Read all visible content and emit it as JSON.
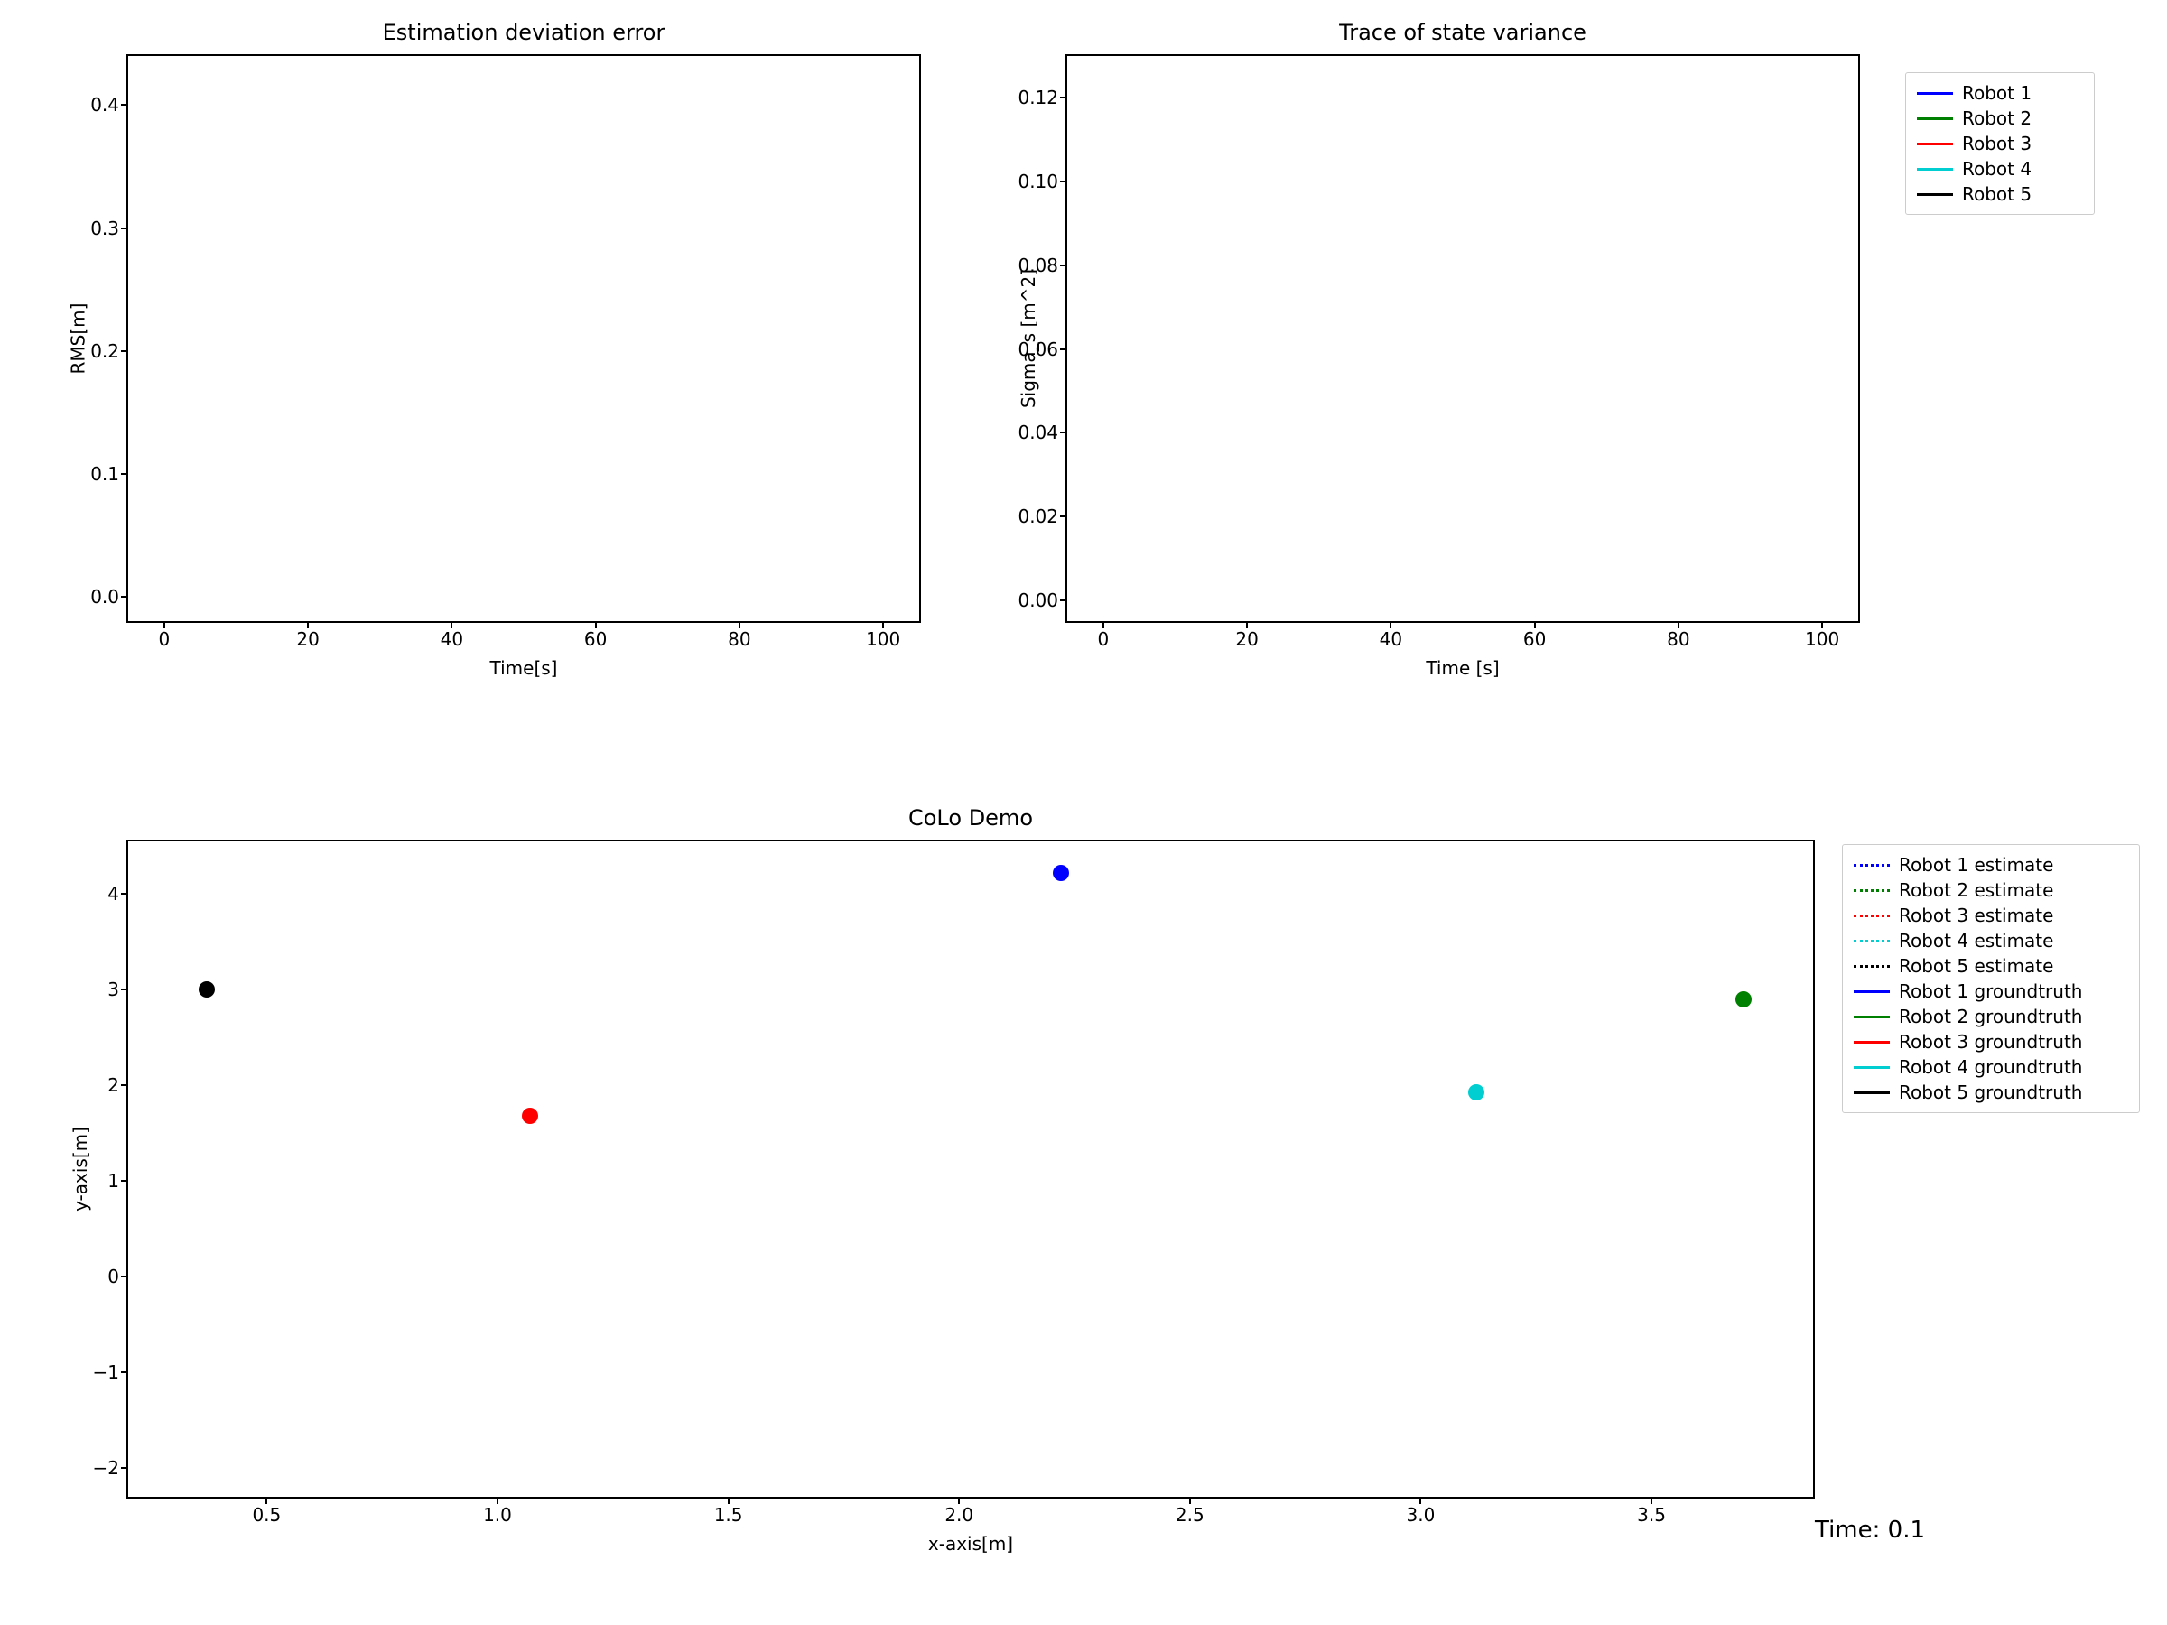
{
  "colors": {
    "robot1": "#0000ff",
    "robot2": "#008000",
    "robot3": "#ff0000",
    "robot4": "#00ced1",
    "robot5": "#000000"
  },
  "chart_data": [
    {
      "id": "top_left",
      "type": "line",
      "title": "Estimation deviation error",
      "xlabel": "Time[s]",
      "ylabel": "RMS[m]",
      "xlim": [
        -5,
        105
      ],
      "ylim": [
        -0.02,
        0.44
      ],
      "xticks": [
        0,
        20,
        40,
        60,
        80,
        100
      ],
      "yticks": [
        0.0,
        0.1,
        0.2,
        0.3,
        0.4
      ],
      "series": []
    },
    {
      "id": "top_right",
      "type": "line",
      "title": "Trace of state variance",
      "xlabel": "Time [s]",
      "ylabel": "Sigma_s [m^2]",
      "xlim": [
        -5,
        105
      ],
      "ylim": [
        -0.005,
        0.13
      ],
      "xticks": [
        0,
        20,
        40,
        60,
        80,
        100
      ],
      "yticks": [
        0.0,
        0.02,
        0.04,
        0.06,
        0.08,
        0.1,
        0.12
      ],
      "series": [],
      "legend": [
        {
          "label": "Robot 1",
          "color_key": "robot1",
          "style": "solid"
        },
        {
          "label": "Robot 2",
          "color_key": "robot2",
          "style": "solid"
        },
        {
          "label": "Robot 3",
          "color_key": "robot3",
          "style": "solid"
        },
        {
          "label": "Robot 4",
          "color_key": "robot4",
          "style": "solid"
        },
        {
          "label": "Robot 5",
          "color_key": "robot5",
          "style": "solid"
        }
      ]
    },
    {
      "id": "bottom",
      "type": "scatter",
      "title": "CoLo Demo",
      "xlabel": "x-axis[m]",
      "ylabel": "y-axis[m]",
      "xlim": [
        0.2,
        3.85
      ],
      "ylim": [
        -2.3,
        4.55
      ],
      "xticks": [
        0.5,
        1.0,
        1.5,
        2.0,
        2.5,
        3.0,
        3.5
      ],
      "yticks": [
        -2,
        -1,
        0,
        1,
        2,
        3,
        4
      ],
      "points": [
        {
          "name": "Robot 5",
          "x": 0.37,
          "y": 3.0,
          "color_key": "robot5"
        },
        {
          "name": "Robot 3",
          "x": 1.07,
          "y": 1.68,
          "color_key": "robot3"
        },
        {
          "name": "Robot 1",
          "x": 2.22,
          "y": 4.22,
          "color_key": "robot1"
        },
        {
          "name": "Robot 4",
          "x": 3.12,
          "y": 1.93,
          "color_key": "robot4"
        },
        {
          "name": "Robot 2",
          "x": 3.7,
          "y": 2.9,
          "color_key": "robot2"
        }
      ],
      "legend": [
        {
          "label": "Robot 1 estimate",
          "color_key": "robot1",
          "style": "dotted"
        },
        {
          "label": "Robot 2 estimate",
          "color_key": "robot2",
          "style": "dotted"
        },
        {
          "label": "Robot 3 estimate",
          "color_key": "robot3",
          "style": "dotted"
        },
        {
          "label": "Robot 4 estimate",
          "color_key": "robot4",
          "style": "dotted"
        },
        {
          "label": "Robot 5 estimate",
          "color_key": "robot5",
          "style": "dotted"
        },
        {
          "label": "Robot 1 groundtruth",
          "color_key": "robot1",
          "style": "solid"
        },
        {
          "label": "Robot 2 groundtruth",
          "color_key": "robot2",
          "style": "solid"
        },
        {
          "label": "Robot 3 groundtruth",
          "color_key": "robot3",
          "style": "solid"
        },
        {
          "label": "Robot 4 groundtruth",
          "color_key": "robot4",
          "style": "solid"
        },
        {
          "label": "Robot 5 groundtruth",
          "color_key": "robot5",
          "style": "solid"
        }
      ],
      "time_annotation": "Time: 0.1"
    }
  ]
}
